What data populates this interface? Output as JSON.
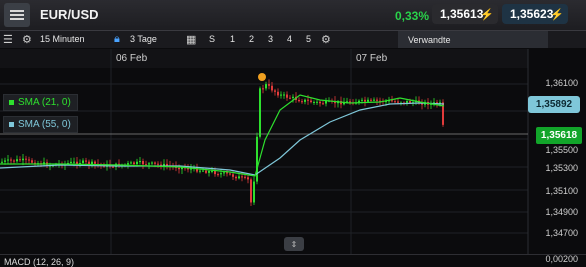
{
  "header": {
    "symbol": "EUR/USD",
    "change_pct": "0,33%",
    "bid": "1,35613",
    "ask": "1,35623"
  },
  "toolbar": {
    "interval": "15 Minuten",
    "range": "3 Tage",
    "zoom_levels": [
      "S",
      "1",
      "2",
      "3",
      "4",
      "5"
    ],
    "related": "Verwandte"
  },
  "chart": {
    "dates": [
      "06 Feb",
      "07 Feb"
    ],
    "price_labels": [
      "1,36100",
      "1,35500",
      "1,35300",
      "1,35100",
      "1,34900",
      "1,34700",
      "0,00200"
    ],
    "indicators": [
      {
        "label": "SMA (21, 0)",
        "color": "#2ee02e"
      },
      {
        "label": "SMA (55, 0)",
        "color": "#7fc7d9"
      }
    ],
    "sma_tag": "1,35892",
    "price_tag": "1,35618",
    "macd_label": "MACD (12, 26, 9)"
  },
  "colors": {
    "up": "#2ee02e",
    "down": "#e23b3b",
    "sma55": "#7fc7d9",
    "accent_up": "#29d14a"
  }
}
